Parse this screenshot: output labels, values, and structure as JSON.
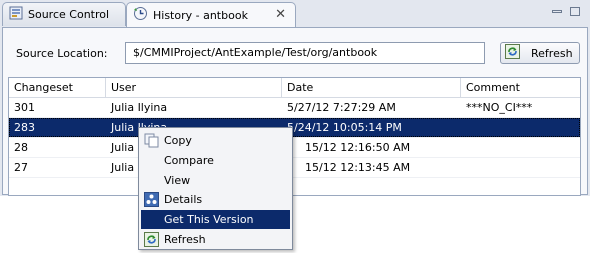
{
  "tabs": [
    {
      "label": "Source Control",
      "icon": "source-control-icon"
    },
    {
      "label": "History - antbook",
      "icon": "history-icon",
      "active": true
    }
  ],
  "source": {
    "label": "Source Location:",
    "value": "$/CMMIProject/AntExample/Test/org/antbook",
    "refresh_label": "Refresh"
  },
  "table": {
    "columns": [
      "Changeset",
      "User",
      "Date",
      "Comment"
    ],
    "rows": [
      {
        "changeset": "301",
        "user": "Julia Ilyina",
        "date": "5/27/12 7:27:29 AM",
        "comment": "***NO_CI***"
      },
      {
        "changeset": "283",
        "user": "Julia Ilyina",
        "date": "5/24/12 10:05:14 PM",
        "comment": ""
      },
      {
        "changeset": "28",
        "user": "Julia I",
        "date": "15/12 12:16:50 AM",
        "comment": ""
      },
      {
        "changeset": "27",
        "user": "Julia I",
        "date": "15/12 12:13:45 AM",
        "comment": ""
      }
    ],
    "selected_row": 1
  },
  "context_menu": {
    "items": [
      {
        "label": "Copy",
        "icon": "copy-icon"
      },
      {
        "label": "Compare",
        "icon": ""
      },
      {
        "label": "View",
        "icon": ""
      },
      {
        "label": "Details",
        "icon": "details-icon"
      },
      {
        "label": "Get This Version",
        "icon": ""
      },
      {
        "label": "Refresh",
        "icon": "refresh-icon"
      }
    ],
    "highlighted": 4
  },
  "colors": {
    "selection": "#0c2a6b",
    "panel": "#e3e7ef",
    "border": "#9aa8bf"
  }
}
